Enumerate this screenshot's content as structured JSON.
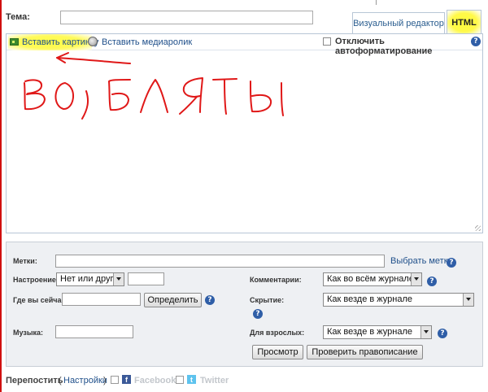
{
  "subject": {
    "label": "Тема:",
    "value": ""
  },
  "tabs": {
    "visual": "Визуальный редактор",
    "html": "HTML"
  },
  "toolbar": {
    "insert_image": "Вставить картинку",
    "insert_media": "Вставить медиаролик",
    "disable_autoformat": "Отключить автоформатирование",
    "help": "?"
  },
  "options": {
    "tags": {
      "label": "Метки:",
      "value": "",
      "link": "Выбрать метки"
    },
    "mood": {
      "label": "Настроение:",
      "selected": "Нет или друго",
      "custom_value": ""
    },
    "location": {
      "label": "Где вы сейчас:",
      "value": "",
      "button": "Определить"
    },
    "music": {
      "label": "Музыка:",
      "value": ""
    },
    "comments": {
      "label": "Комментарии:",
      "selected": "Как во всём журнале"
    },
    "privacy": {
      "label": "Скрытие:",
      "selected": "Как везде в журнале"
    },
    "adult": {
      "label": "Для взрослых:",
      "selected": "Как везде в журнале"
    },
    "preview_button": "Просмотр",
    "spellcheck_button": "Проверить правописание",
    "help": "?"
  },
  "footer": {
    "repost_label": "Перепостить",
    "paren_open": "(",
    "settings_link": "Настройки",
    "paren_close": ")",
    "facebook": "Facebook",
    "twitter": "Twitter",
    "facebook_glyph": "f",
    "twitter_glyph": "t"
  },
  "colors": {
    "annotation_red": "#e01818",
    "highlight_yellow": "#fffc3a",
    "link_blue": "#1f4f8a",
    "help_blue": "#2f5ea7",
    "panel_bg": "#eef0f3"
  }
}
